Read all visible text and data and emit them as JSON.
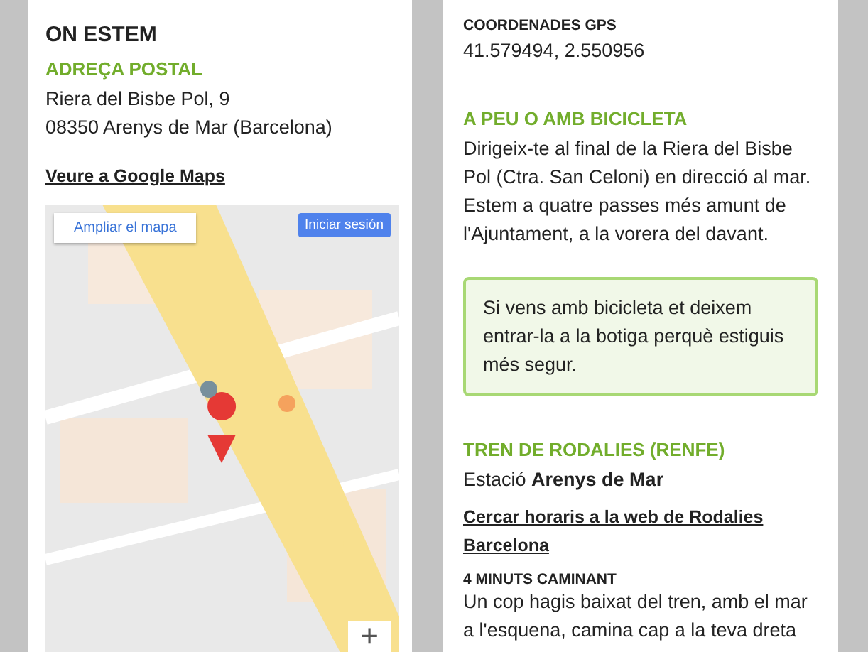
{
  "left": {
    "title": "ON ESTEM",
    "address_heading": "ADREÇA POSTAL",
    "address_lines": [
      "Riera del Bisbe Pol, 9",
      "08350 Arenys de Mar (Barcelona)"
    ],
    "maps_link": "Veure a Google Maps",
    "map": {
      "kind": "picture",
      "enlarge_button": "Ampliar el mapa",
      "sign_in_button": "Iniciar sesión",
      "zoom_in_button": "+"
    }
  },
  "right": {
    "gps_label": "COORDENADES GPS",
    "gps_value": "41.579494, 2.550956",
    "sections": [
      {
        "kind": "text",
        "heading": "A PEU O AMB BICICLETA",
        "body": "Dirigeix-te al final de la Riera del Bisbe Pol (Ctra. San Celoni) en direcció al mar. Estem a quatre passes més amunt de l'Ajuntament, a la vorera del davant.",
        "note": "Si vens amb bicicleta et deixem entrar-la a la botiga perquè estiguis més segur."
      },
      {
        "kind": "train",
        "heading": "TREN DE RODALIES (RENFE)",
        "body": "Estació **Arenys de Mar**",
        "link": "Cercar horaris a la web de Rodalies Barcelona",
        "subheading": "4 MINUTS CAMINANT",
        "text": "Un cop hagis baixat del tren, amb el mar a l'esquena, camina cap a la teva dreta"
      }
    ]
  }
}
